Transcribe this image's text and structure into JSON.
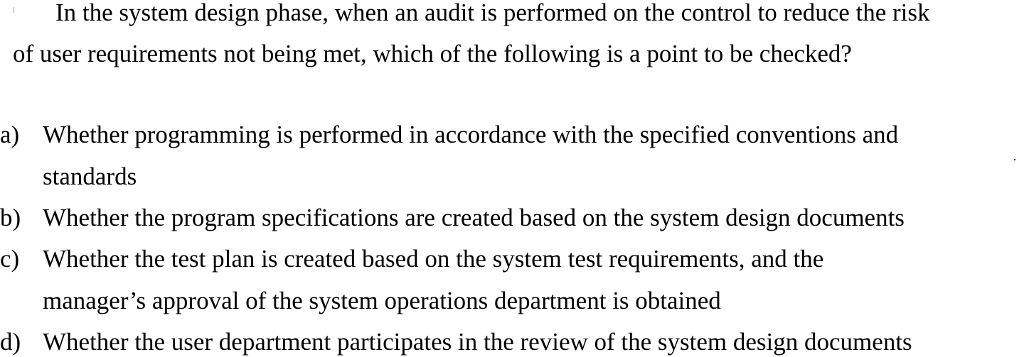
{
  "question": {
    "line1": "In the system design phase, when an audit is performed on the control to reduce the risk",
    "line2": "of user requirements not being met, which of the following is a point to be checked?"
  },
  "options": [
    {
      "letter": "a)",
      "lines": [
        "Whether programming is performed in accordance with the specified conventions and",
        "standards"
      ]
    },
    {
      "letter": "b)",
      "lines": [
        "Whether the program specifications are created based on the system design documents"
      ]
    },
    {
      "letter": "c)",
      "lines": [
        "Whether the test plan is created based on the system test requirements, and the",
        "manager’s approval of the system operations department is obtained"
      ]
    },
    {
      "letter": "d)",
      "lines": [
        "Whether the user department participates in the review of the system design documents"
      ]
    }
  ]
}
